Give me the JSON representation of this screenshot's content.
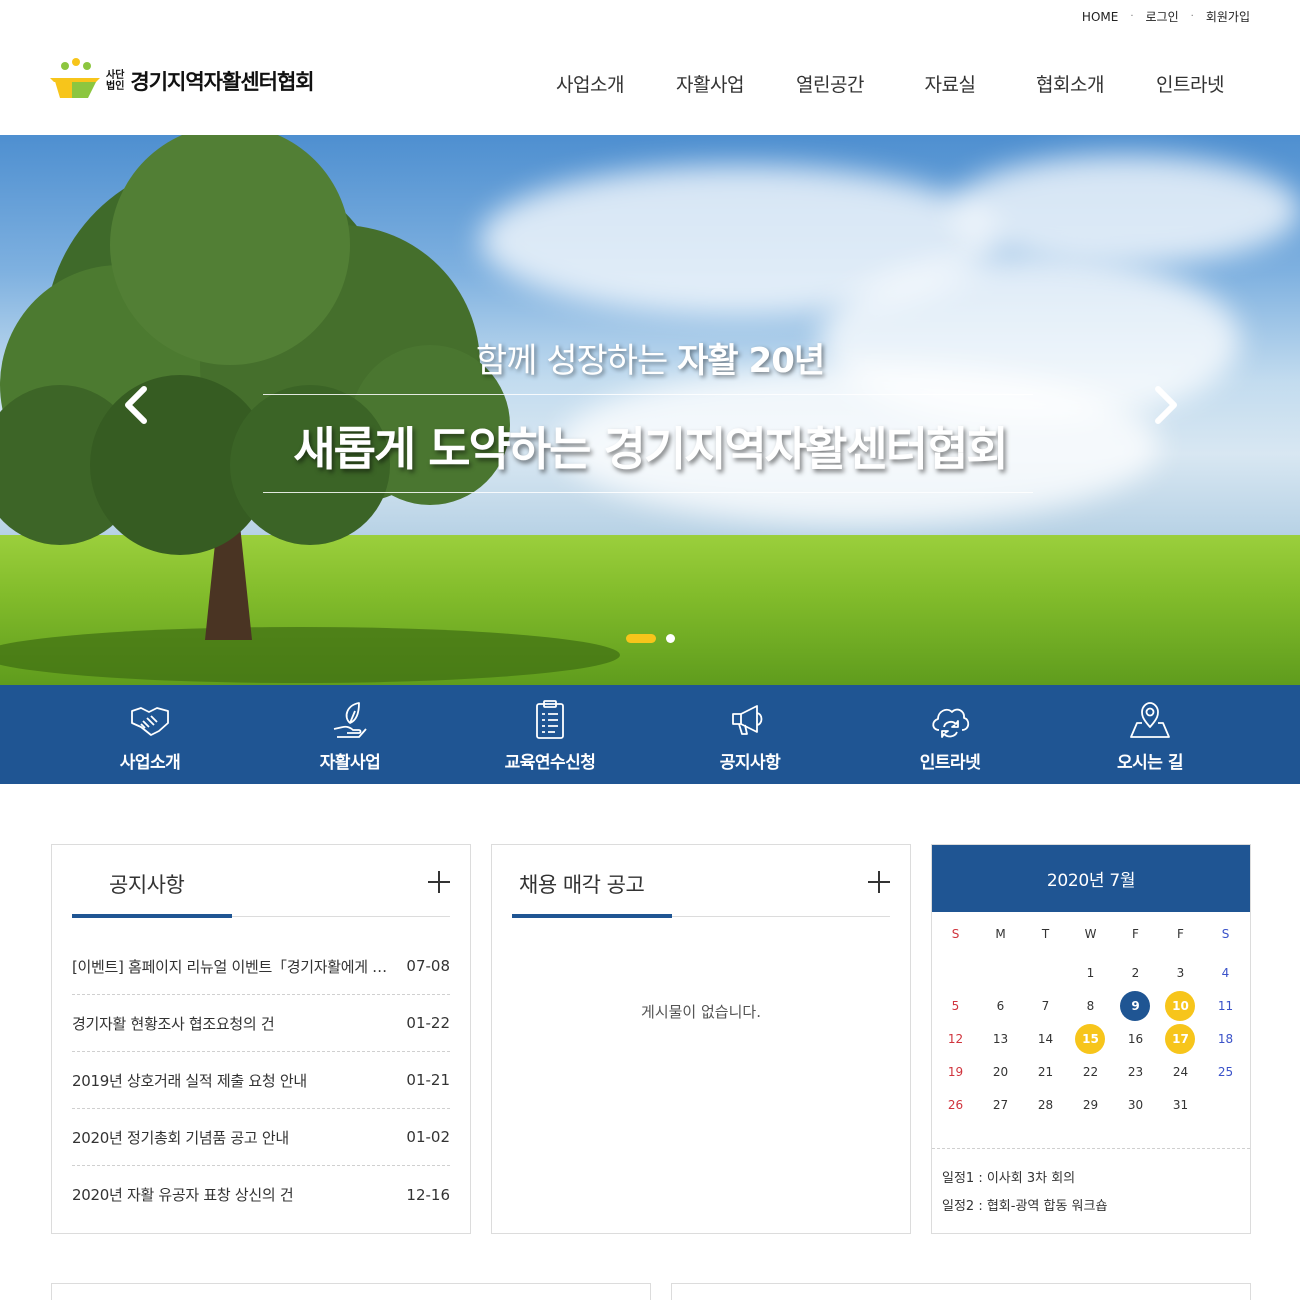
{
  "util": {
    "home": "HOME",
    "login": "로그인",
    "join": "회원가입",
    "sep": "·"
  },
  "logo": {
    "sub1": "사단",
    "sub2": "법인",
    "name": "경기지역자활센터협회"
  },
  "nav": [
    "사업소개",
    "자활사업",
    "열린공간",
    "자료실",
    "협회소개",
    "인트라넷"
  ],
  "hero": {
    "line1_normal": "함께 성장하는 ",
    "line1_bold": "자활 20년",
    "line2": "새롭게 도약하는 경기지역자활센터협회",
    "slides": 2,
    "active_slide": 1
  },
  "quick": [
    {
      "label": "사업소개",
      "icon": "handshake-icon"
    },
    {
      "label": "자활사업",
      "icon": "leaf-hand-icon"
    },
    {
      "label": "교육연수신청",
      "icon": "clipboard-icon"
    },
    {
      "label": "공지사항",
      "icon": "megaphone-icon"
    },
    {
      "label": "인트라넷",
      "icon": "cloud-sync-icon"
    },
    {
      "label": "오시는 길",
      "icon": "map-pin-icon"
    }
  ],
  "notice": {
    "title": "공지사항",
    "items": [
      {
        "title": "[이벤트] 홈페이지 리뉴얼 이벤트「경기자활에게 …",
        "date": "07-08"
      },
      {
        "title": "경기자활 현황조사 협조요청의 건",
        "date": "01-22"
      },
      {
        "title": "2019년 상호거래 실적 제출 요청 안내",
        "date": "01-21"
      },
      {
        "title": "2020년 정기총회 기념품 공고 안내",
        "date": "01-02"
      },
      {
        "title": "2020년 자활 유공자 표창 상신의 건",
        "date": "12-16"
      }
    ]
  },
  "recruit": {
    "title": "채용 매각 공고",
    "empty": "게시물이 없습니다."
  },
  "calendar": {
    "title": "2020년  7월",
    "dow": [
      "S",
      "M",
      "T",
      "W",
      "F",
      "F",
      "S"
    ],
    "weeks": [
      [
        "",
        "",
        "",
        "1",
        "2",
        "3",
        "4"
      ],
      [
        "5",
        "6",
        "7",
        "8",
        "9",
        "10",
        "11"
      ],
      [
        "12",
        "13",
        "14",
        "15",
        "16",
        "17",
        "18"
      ],
      [
        "19",
        "20",
        "21",
        "22",
        "23",
        "24",
        "25"
      ],
      [
        "26",
        "27",
        "28",
        "29",
        "30",
        "31",
        ""
      ]
    ],
    "today": "9",
    "events": [
      "10",
      "15",
      "17"
    ],
    "schedule": [
      "일정1 : 이사회 3차 회의",
      "일정2 : 협회-광역 합동 워크숍"
    ],
    "colors": {
      "today": "#1f5593",
      "event": "#f7c51b",
      "sun": "#d0343d",
      "sat": "#3a52c9"
    }
  },
  "colors": {
    "brand": "#1f5593",
    "accent": "#f7c51b"
  }
}
